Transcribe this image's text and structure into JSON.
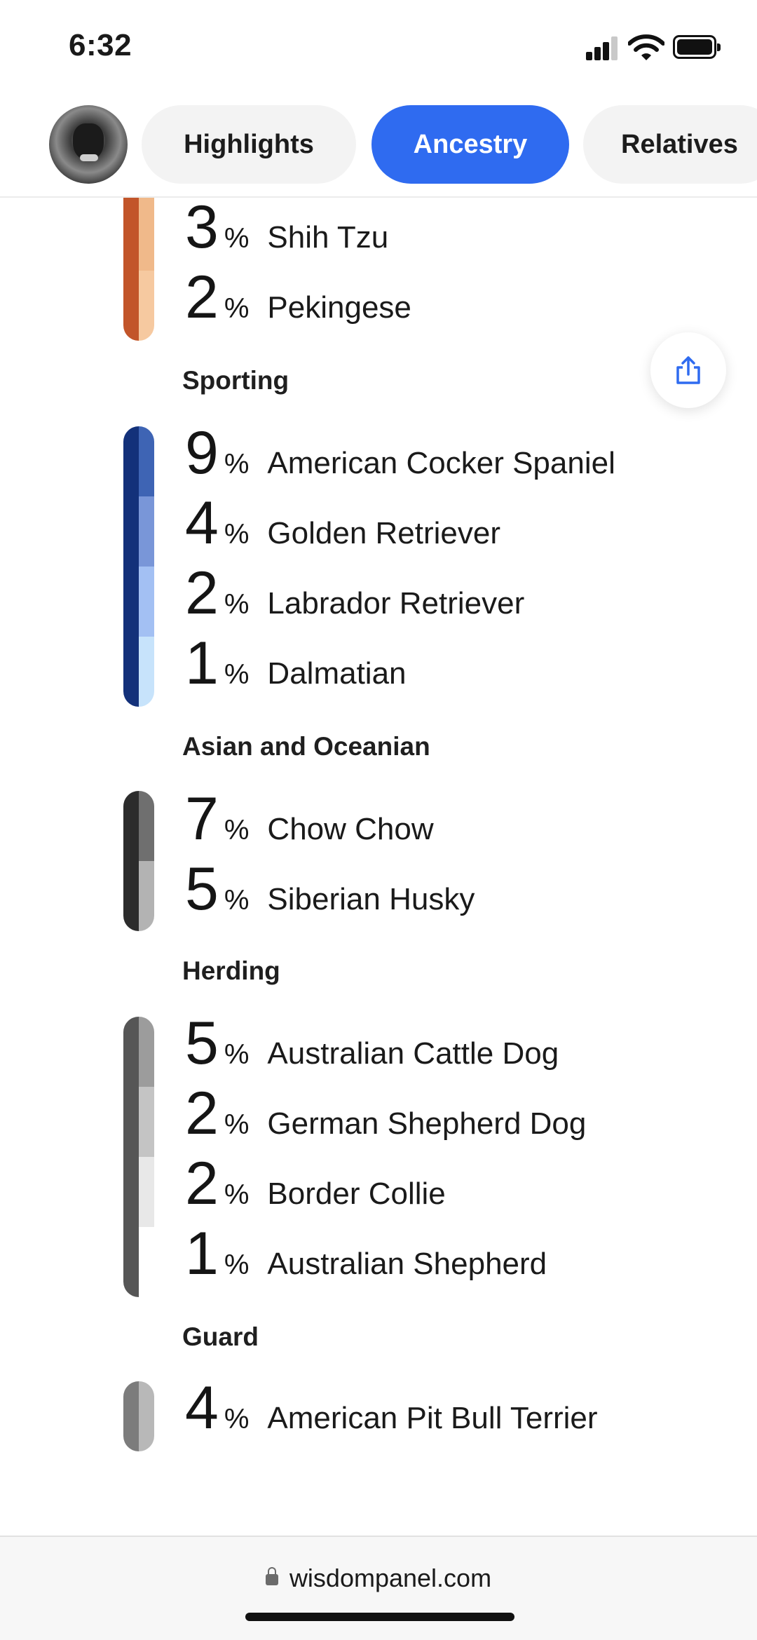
{
  "status_bar": {
    "time": "6:32"
  },
  "nav": {
    "tabs": [
      {
        "label": "Highlights",
        "active": false
      },
      {
        "label": "Ancestry",
        "active": true
      },
      {
        "label": "Relatives",
        "active": false
      }
    ]
  },
  "colors": {
    "accent": "#2f6bf0"
  },
  "groups": [
    {
      "heading": "",
      "bar_colors": [
        "#c2552a",
        "#f6c9a0",
        "#fbe1bd"
      ],
      "breeds": [
        {
          "percent": "3",
          "name": "Shih Tzu"
        },
        {
          "percent": "2",
          "name": "Pekingese"
        }
      ]
    },
    {
      "heading": "Sporting",
      "bar_colors": [
        "#13317a",
        "#3e64b4",
        "#7996d8",
        "#a3c0f3",
        "#c7e3fb"
      ],
      "breeds": [
        {
          "percent": "9",
          "name": "American Cocker Spaniel"
        },
        {
          "percent": "4",
          "name": "Golden Retriever"
        },
        {
          "percent": "2",
          "name": "Labrador Retriever"
        },
        {
          "percent": "1",
          "name": "Dalmatian"
        }
      ]
    },
    {
      "heading": "Asian and Oceanian",
      "bar_colors": [
        "#2c2c2c",
        "#6f6f6f",
        "#b3b3b3"
      ],
      "breeds": [
        {
          "percent": "7",
          "name": "Chow Chow"
        },
        {
          "percent": "5",
          "name": "Siberian Husky"
        }
      ]
    },
    {
      "heading": "Herding",
      "bar_colors": [
        "#565656",
        "#9c9c9c",
        "#c4c4c4",
        "#e8e8e8",
        "#565656"
      ],
      "breeds": [
        {
          "percent": "5",
          "name": "Australian Cattle Dog"
        },
        {
          "percent": "2",
          "name": "German Shepherd Dog"
        },
        {
          "percent": "2",
          "name": "Border Collie"
        },
        {
          "percent": "1",
          "name": "Australian Shepherd"
        }
      ]
    },
    {
      "heading": "Guard",
      "bar_colors": [
        "#7c7c7c",
        "#b8b8b8"
      ],
      "breeds": [
        {
          "percent": "4",
          "name": "American Pit Bull Terrier"
        }
      ]
    }
  ],
  "icons": {
    "share": "share-icon",
    "lock": "lock-icon",
    "profile": "dog-avatar"
  },
  "footer": {
    "url": "wisdompanel.com"
  }
}
